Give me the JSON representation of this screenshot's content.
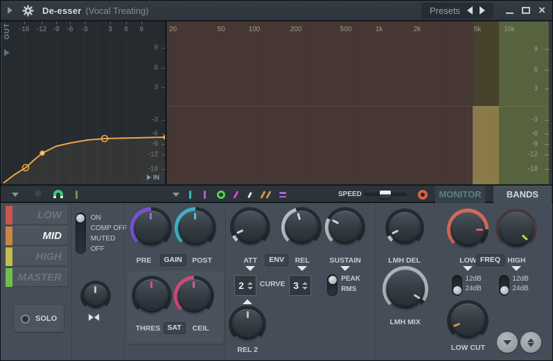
{
  "window": {
    "title": "De-esser",
    "subtitle": "(Vocal Treating)",
    "presets_label": "Presets"
  },
  "graph": {
    "axis_label_out": "OUT",
    "axis_label_in": "IN",
    "x_ticks": [
      "-18",
      "-12",
      "-9",
      "-6",
      "-3",
      "3",
      "6",
      "9"
    ],
    "y_ticks": [
      "9",
      "6",
      "3",
      "-3",
      "-6",
      "-9",
      "-12",
      "-18"
    ],
    "curve_points": [
      [
        2,
        233
      ],
      [
        18,
        221
      ],
      [
        34,
        211
      ],
      [
        46,
        200
      ],
      [
        58,
        190
      ],
      [
        78,
        180
      ],
      [
        100,
        175
      ],
      [
        124,
        171
      ],
      [
        148,
        169
      ],
      [
        190,
        168
      ],
      [
        236,
        167
      ]
    ],
    "curve_markers": [
      {
        "x": 34,
        "y": 211,
        "type": "open"
      },
      {
        "x": 58,
        "y": 190,
        "type": "filled"
      },
      {
        "x": 148,
        "y": 169,
        "type": "open"
      },
      {
        "x": 236,
        "y": 167,
        "type": "filled"
      }
    ]
  },
  "spectrum": {
    "freq_ticks": [
      "20",
      "50",
      "100",
      "200",
      "500",
      "1k",
      "2k",
      "5k",
      "10k"
    ],
    "db_ticks": [
      "9",
      "6",
      "3",
      "-3",
      "-6",
      "-9",
      "-12",
      "-18"
    ]
  },
  "toolbar": {
    "speed_label": "SPEED",
    "monitor_tab": "MONITOR",
    "bands_tab": "BANDS"
  },
  "bands": {
    "items": [
      {
        "label": "LOW",
        "color": "#c9564e"
      },
      {
        "label": "MID",
        "color": "#c9883f"
      },
      {
        "label": "HIGH",
        "color": "#c3bf4a"
      },
      {
        "label": "MASTER",
        "color": "#6fbe4f"
      }
    ],
    "selected": "MID",
    "solo_label": "SOLO"
  },
  "state_switch": {
    "options": [
      "ON",
      "COMP OFF",
      "MUTED",
      "OFF"
    ],
    "selected": "ON"
  },
  "gain_section": {
    "pre_label": "PRE",
    "gain_label": "GAIN",
    "post_label": "POST"
  },
  "comp_section": {
    "thres_label": "THRES",
    "sat_label": "SAT",
    "ceil_label": "CEIL"
  },
  "env_section": {
    "att_label": "ATT",
    "env_label": "ENV",
    "rel_label": "REL",
    "sustain_label": "SUSTAIN",
    "att_value": "2",
    "curve_label": "CURVE",
    "curve_value": "3",
    "detect_options": [
      "PEAK",
      "RMS"
    ],
    "detect_selected": "PEAK",
    "rel2_label": "REL 2"
  },
  "lmh_section": {
    "del_label": "LMH DEL",
    "mix_label": "LMH MIX"
  },
  "freq_section": {
    "low_label": "LOW",
    "freq_label": "FREQ",
    "high_label": "HIGH",
    "slope_options": [
      "12dB",
      "24dB"
    ],
    "low_slope": "24dB",
    "high_slope": "24dB",
    "low_cut_label": "LOW CUT"
  },
  "colors": {
    "curve_orange": "#eda64e",
    "arc_purple": "#7a52d6",
    "arc_cyan": "#3cb4c8",
    "arc_pink": "#d04878",
    "arc_red": "#d4695a",
    "ind_yellow_green": "#c8d438",
    "ind_orange": "#d8923c",
    "record_red": "#de5e47",
    "magnet_green": "#38cf7c",
    "band_highlight": "#8a7a4a",
    "spectrum_low_bg": "#463734",
    "spectrum_high_bg": "#57623e"
  }
}
